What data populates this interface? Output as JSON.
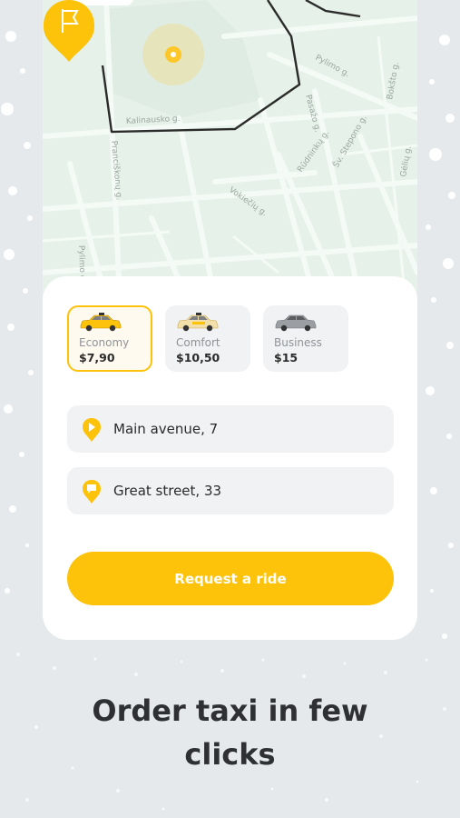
{
  "map": {
    "streets": [
      "Pylimo g.",
      "Pylimo g.",
      "Pranciškonų g.",
      "Kalinausko g.",
      "Rūdninkų g.",
      "Pasažo g.",
      "Gėlių g.",
      "Šv. Stepono g.",
      "Bokšto g.",
      "Vokiečių g."
    ]
  },
  "ride_options": [
    {
      "name": "Economy",
      "price": "$7,90",
      "selected": true,
      "car_color": "#fdc20a"
    },
    {
      "name": "Comfort",
      "price": "$10,50",
      "selected": false,
      "car_color": "#fdc20a"
    },
    {
      "name": "Business",
      "price": "$15",
      "selected": false,
      "car_color": "#9b9ea3"
    }
  ],
  "route": {
    "from": "Main avenue, 7",
    "to": "Great street, 33"
  },
  "cta_label": "Request a ride",
  "headline": {
    "line1": "Order taxi in few",
    "line2": "clicks"
  },
  "colors": {
    "accent": "#fdc20a",
    "route_line": "#2b2b2b",
    "map_bg": "#e5f1e9"
  },
  "icons": [
    "play-pin-icon",
    "flag-pin-icon",
    "location-marker-icon",
    "taxi-car-icon",
    "message-pin-icon"
  ]
}
